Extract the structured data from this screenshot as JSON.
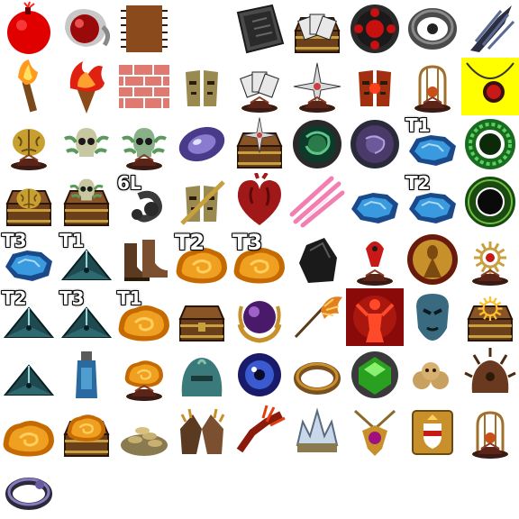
{
  "sheet": {
    "icons": [
      {
        "name": "red-bomb-icon",
        "label": ""
      },
      {
        "name": "ruby-orb-icon",
        "label": ""
      },
      {
        "name": "circuit-chip-icon",
        "label": ""
      },
      {
        "name": "empty-slot",
        "label": ""
      },
      {
        "name": "dark-card-icon",
        "label": ""
      },
      {
        "name": "card-chest-icon",
        "label": ""
      },
      {
        "name": "red-seal-icon",
        "label": ""
      },
      {
        "name": "twisted-ring-icon",
        "label": ""
      },
      {
        "name": "dark-claw-icon",
        "label": ""
      },
      {
        "name": "torch-icon",
        "label": ""
      },
      {
        "name": "flame-torch-icon",
        "label": ""
      },
      {
        "name": "brick-wall-icon",
        "label": ""
      },
      {
        "name": "twin-idol-icon",
        "label": ""
      },
      {
        "name": "card-pedestal-icon",
        "label": ""
      },
      {
        "name": "compass-star-icon",
        "label": ""
      },
      {
        "name": "ruby-idol-icon",
        "label": ""
      },
      {
        "name": "cage-relic-icon",
        "label": ""
      },
      {
        "name": "ruby-amulet-icon",
        "label": ""
      },
      {
        "name": "golden-brain-icon",
        "label": ""
      },
      {
        "name": "skull-green-icon",
        "label": ""
      },
      {
        "name": "skull-pedestal-icon",
        "label": ""
      },
      {
        "name": "purple-disc-icon",
        "label": ""
      },
      {
        "name": "compass-chest-icon",
        "label": ""
      },
      {
        "name": "green-seal-icon",
        "label": ""
      },
      {
        "name": "violet-seal-icon",
        "label": ""
      },
      {
        "name": "blue-ore-icon",
        "label": "T1"
      },
      {
        "name": "green-ring-icon",
        "label": ""
      },
      {
        "name": "brain-chest-icon",
        "label": ""
      },
      {
        "name": "skull-chest-icon",
        "label": ""
      },
      {
        "name": "socket-link-icon",
        "label": "6L"
      },
      {
        "name": "idol-sword-icon",
        "label": ""
      },
      {
        "name": "heart-icon",
        "label": ""
      },
      {
        "name": "pink-slash-icon",
        "label": ""
      },
      {
        "name": "blue-ore-icon",
        "label": ""
      },
      {
        "name": "blue-ore-icon",
        "label": "T2"
      },
      {
        "name": "dark-ring-icon",
        "label": ""
      },
      {
        "name": "blue-ore-icon",
        "label": "T3"
      },
      {
        "name": "prism-icon",
        "label": "T1"
      },
      {
        "name": "boots-icon",
        "label": ""
      },
      {
        "name": "amber-icon",
        "label": "T2"
      },
      {
        "name": "amber-icon",
        "label": "T3"
      },
      {
        "name": "obsidian-icon",
        "label": ""
      },
      {
        "name": "beak-pedestal-icon",
        "label": ""
      },
      {
        "name": "goddess-icon",
        "label": ""
      },
      {
        "name": "gear-pedestal-icon",
        "label": ""
      },
      {
        "name": "prism-icon",
        "label": "T2"
      },
      {
        "name": "prism-icon",
        "label": "T3"
      },
      {
        "name": "amber-icon",
        "label": "T1"
      },
      {
        "name": "treasure-chest-icon",
        "label": ""
      },
      {
        "name": "purple-orb-claw-icon",
        "label": ""
      },
      {
        "name": "bird-feather-icon",
        "label": ""
      },
      {
        "name": "red-figure-icon",
        "label": ""
      },
      {
        "name": "blue-mask-icon",
        "label": ""
      },
      {
        "name": "sun-chest-icon",
        "label": ""
      },
      {
        "name": "prism-icon",
        "label": ""
      },
      {
        "name": "blue-flask-icon",
        "label": ""
      },
      {
        "name": "amber-pedestal-icon",
        "label": ""
      },
      {
        "name": "teal-helm-icon",
        "label": ""
      },
      {
        "name": "blue-eye-icon",
        "label": ""
      },
      {
        "name": "bronze-ring-icon",
        "label": ""
      },
      {
        "name": "green-gem-icon",
        "label": ""
      },
      {
        "name": "skull-pile-icon",
        "label": ""
      },
      {
        "name": "spiked-helm-icon",
        "label": ""
      },
      {
        "name": "amber-icon",
        "label": ""
      },
      {
        "name": "amber-chest-icon",
        "label": ""
      },
      {
        "name": "coin-pile-icon",
        "label": ""
      },
      {
        "name": "gauntlets-icon",
        "label": ""
      },
      {
        "name": "fire-claw-icon",
        "label": ""
      },
      {
        "name": "ice-crown-icon",
        "label": ""
      },
      {
        "name": "gem-amulet-icon",
        "label": ""
      },
      {
        "name": "gold-crest-icon",
        "label": ""
      },
      {
        "name": "cage-relic-icon",
        "label": ""
      },
      {
        "name": "violet-ring-icon",
        "label": ""
      }
    ]
  }
}
